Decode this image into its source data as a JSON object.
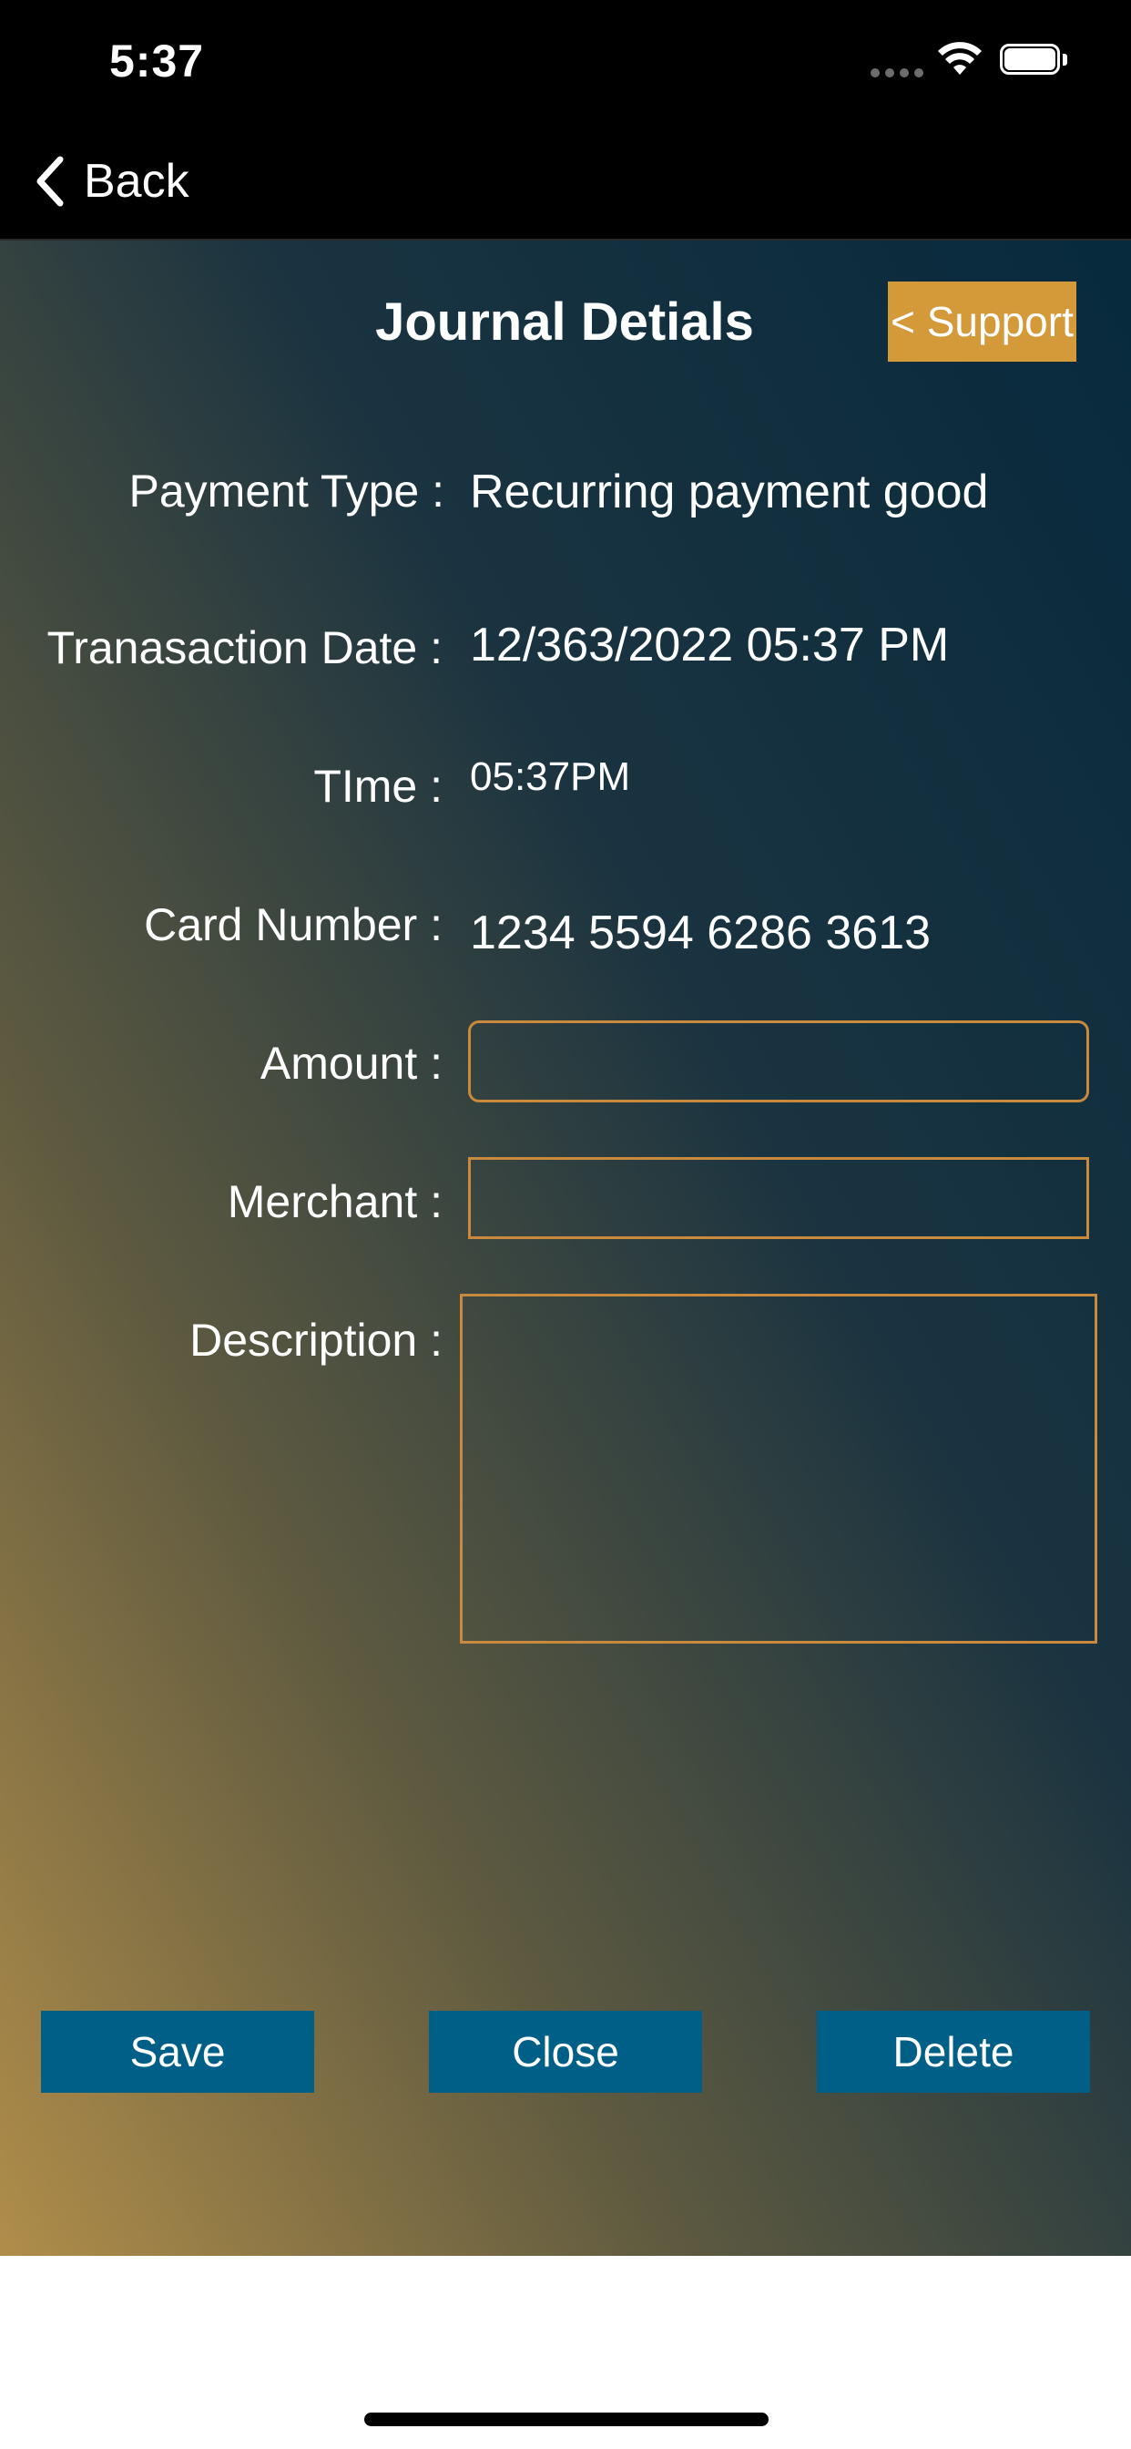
{
  "status_bar": {
    "time": "5:37"
  },
  "nav": {
    "back_label": "Back"
  },
  "header": {
    "title": "Journal Detials",
    "support_label": "< Support"
  },
  "fields": {
    "payment_type": {
      "label": "Payment Type :",
      "value": "Recurring payment good"
    },
    "transaction_date": {
      "label": "Tranasaction Date :",
      "value": "12/363/2022 05:37 PM"
    },
    "time": {
      "label": "TIme :",
      "value": "05:37PM"
    },
    "card_number": {
      "label": "Card Number :",
      "value": "1234 5594 6286 3613"
    },
    "amount": {
      "label": "Amount :",
      "value": ""
    },
    "merchant": {
      "label": "Merchant :",
      "value": ""
    },
    "description": {
      "label": "Description :",
      "value": ""
    }
  },
  "actions": {
    "save_label": "Save",
    "close_label": "Close",
    "delete_label": "Delete"
  },
  "colors": {
    "accent": "#d49a3a",
    "button": "#005f86",
    "input_border": "#c98a3e"
  },
  "icons": {
    "back": "chevron-left-icon",
    "wifi": "wifi-icon",
    "battery": "battery-icon",
    "signal": "signal-dots-icon"
  }
}
